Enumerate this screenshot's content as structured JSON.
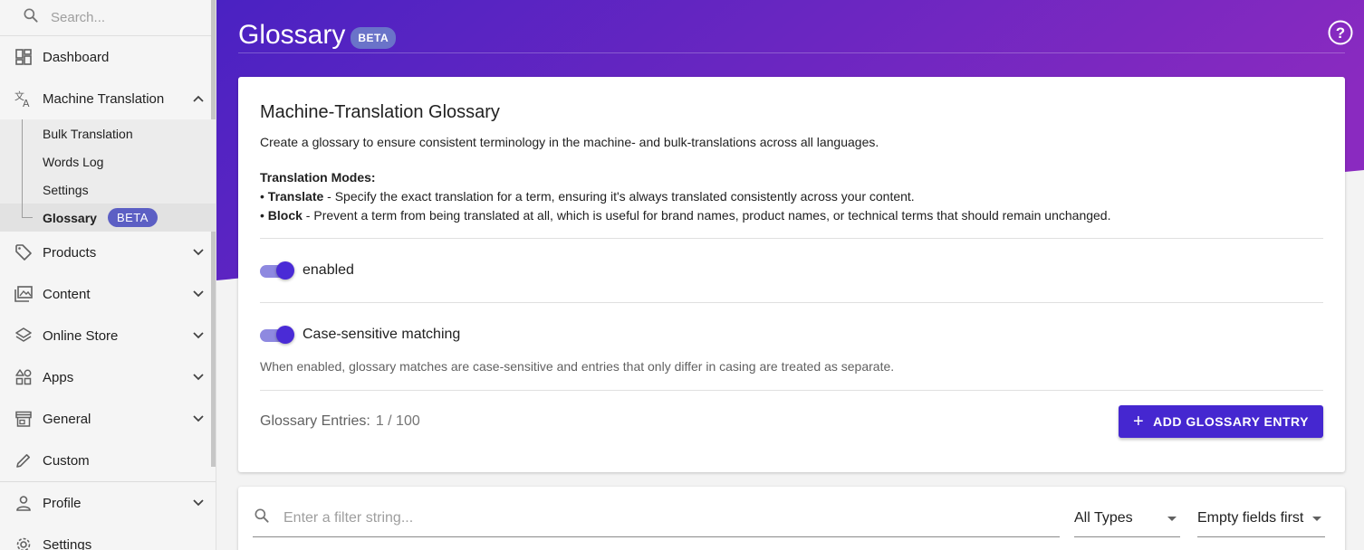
{
  "sidebar": {
    "search_placeholder": "Search...",
    "items": {
      "dashboard": "Dashboard",
      "machine_translation": "Machine Translation",
      "products": "Products",
      "content": "Content",
      "online_store": "Online Store",
      "apps": "Apps",
      "general": "General",
      "custom": "Custom",
      "profile": "Profile",
      "settings": "Settings"
    },
    "sub_items": {
      "bulk_translation": "Bulk Translation",
      "words_log": "Words Log",
      "settings": "Settings",
      "glossary": "Glossary",
      "glossary_badge": "BETA"
    }
  },
  "header": {
    "title": "Glossary",
    "badge": "BETA",
    "help_label": "?"
  },
  "card": {
    "heading": "Machine-Translation Glossary",
    "description": "Create a glossary to ensure consistent terminology in the machine- and bulk-translations across all languages.",
    "modes_title": "Translation Modes:",
    "mode_translate_name": "Translate",
    "mode_translate_desc": " - Specify the exact translation for a term, ensuring it's always translated consistently across your content.",
    "mode_block_name": "Block",
    "mode_block_desc": " - Prevent a term from being translated at all, which is useful for brand names, product names, or technical terms that should remain unchanged.",
    "bullet": "• ",
    "enabled_label": "enabled",
    "enabled_on": true,
    "case_label": "Case-sensitive matching",
    "case_on": true,
    "case_hint": "When enabled, glossary matches are case-sensitive and entries that only differ in casing are treated as separate.",
    "entries_label": "Glossary Entries:",
    "entries_count": "1 / 100",
    "add_button": "ADD GLOSSARY ENTRY"
  },
  "filter": {
    "placeholder": "Enter a filter string...",
    "type_select": "All Types",
    "sort_select": "Empty fields first"
  },
  "colors": {
    "accent": "#4527d0",
    "hero_start": "#4a22c2",
    "hero_end": "#8a2ac0",
    "badge": "#5c5fc4"
  }
}
